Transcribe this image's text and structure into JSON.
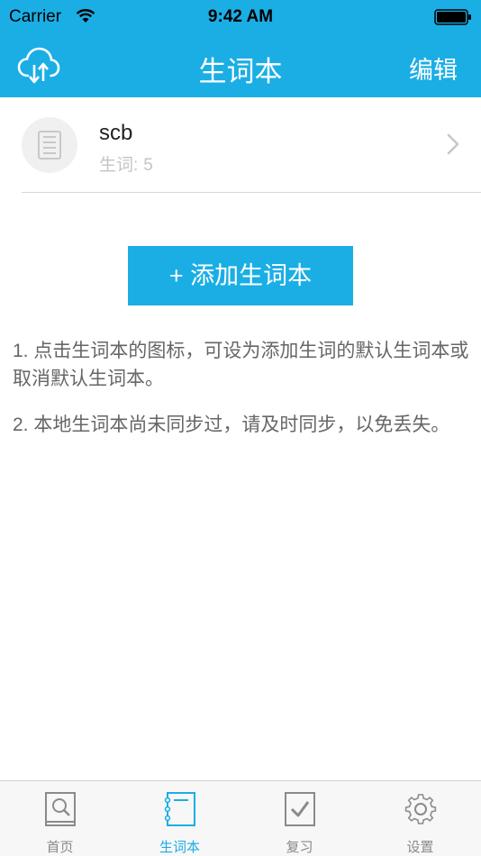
{
  "status_bar": {
    "carrier": "Carrier",
    "time": "9:42 AM"
  },
  "nav": {
    "title": "生词本",
    "edit_label": "编辑",
    "cloud_icon": "cloud-sync-icon"
  },
  "notebooks": [
    {
      "name": "scb",
      "count_label": "生词:",
      "count": "5"
    }
  ],
  "add_button_label": "+ 添加生词本",
  "tips": [
    "1. 点击生词本的图标，可设为添加生词的默认生词本或取消默认生词本。",
    "2. 本地生词本尚未同步过，请及时同步，以免丢失。"
  ],
  "tabs": [
    {
      "label": "首页",
      "icon": "search-book-icon"
    },
    {
      "label": "生词本",
      "icon": "notebook-icon",
      "active": true
    },
    {
      "label": "复习",
      "icon": "checkbox-icon"
    },
    {
      "label": "设置",
      "icon": "gear-icon"
    }
  ],
  "colors": {
    "accent": "#1aaee5",
    "text_gray": "#666666",
    "muted": "#c4c4c4"
  }
}
